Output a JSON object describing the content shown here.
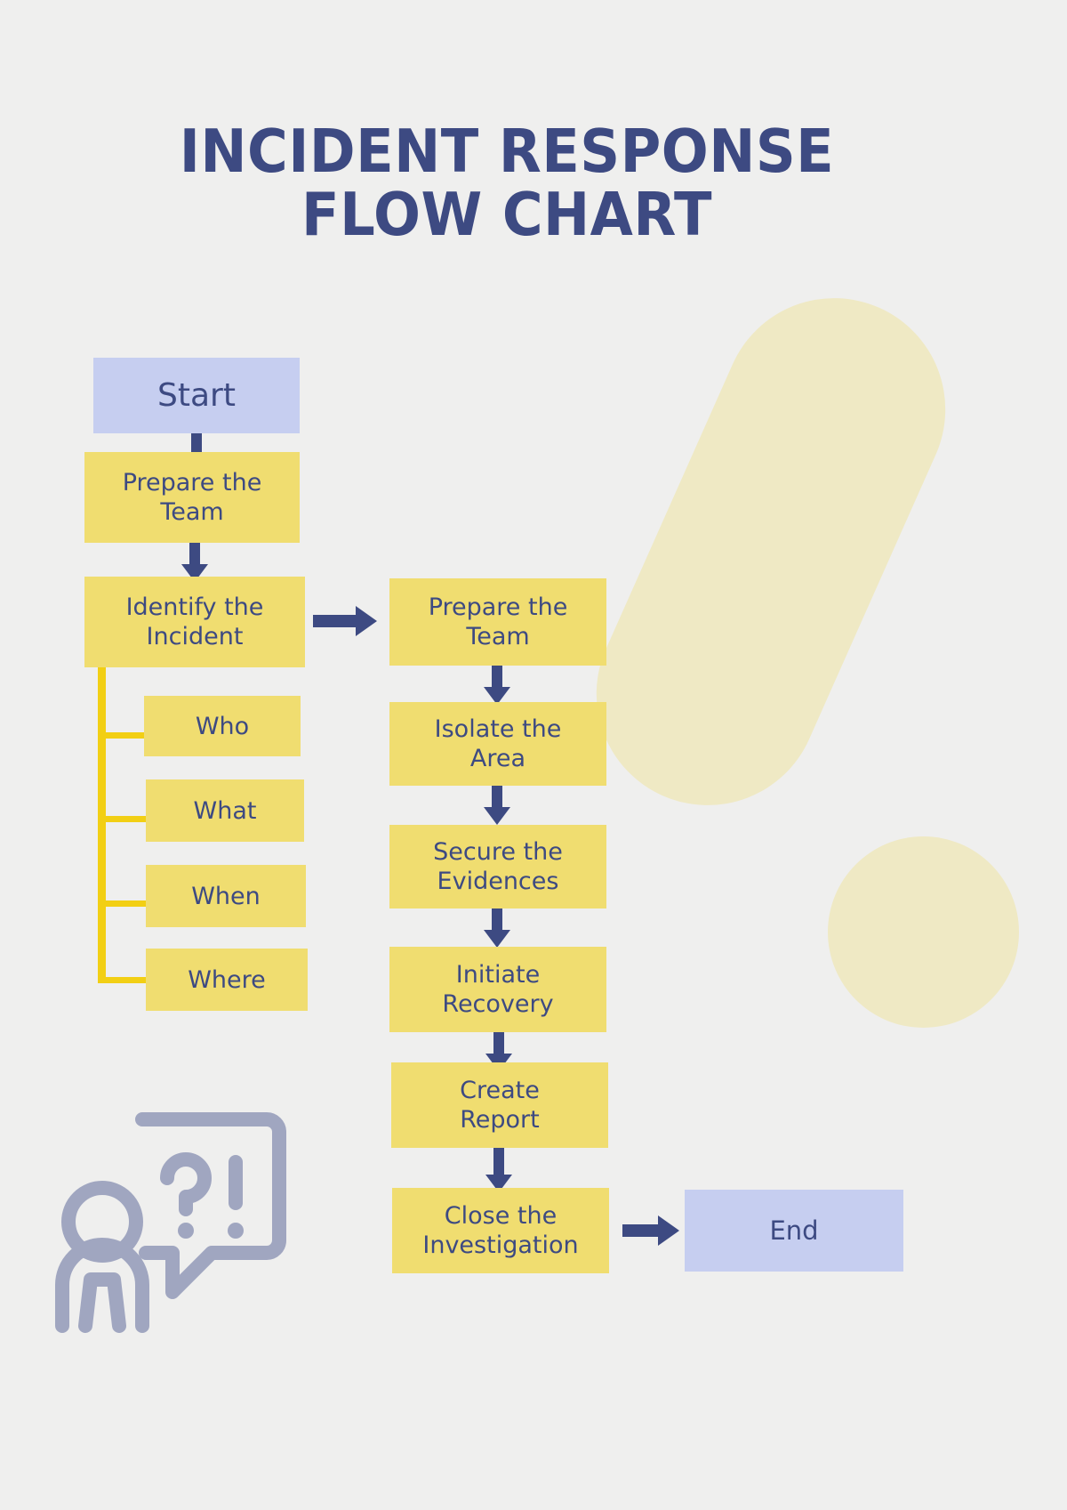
{
  "title": {
    "line1": "INCIDENT RESPONSE",
    "line2": "FLOW CHART"
  },
  "colors": {
    "background": "#efefee",
    "accent_navy": "#3d4a82",
    "box_yellow": "#f0dd70",
    "box_blue": "#c6cef0",
    "bracket_gold": "#f2cf14",
    "decor_pale_yellow": "#efe9c4",
    "icon_gray": "#a0a6c0"
  },
  "chart_data": {
    "type": "diagram",
    "diagram_type": "flowchart",
    "title": "Incident Response Flow Chart",
    "nodes": [
      {
        "id": "start",
        "label": "Start",
        "shape": "rect",
        "fill": "#c6cef0",
        "column": "left"
      },
      {
        "id": "prepare1",
        "label": "Prepare the Team",
        "shape": "rect",
        "fill": "#f0dd70",
        "column": "left"
      },
      {
        "id": "identify",
        "label": "Identify the Incident",
        "shape": "rect",
        "fill": "#f0dd70",
        "column": "left"
      },
      {
        "id": "who",
        "label": "Who",
        "shape": "rect",
        "fill": "#f0dd70",
        "column": "left-sub"
      },
      {
        "id": "what",
        "label": "What",
        "shape": "rect",
        "fill": "#f0dd70",
        "column": "left-sub"
      },
      {
        "id": "when",
        "label": "When",
        "shape": "rect",
        "fill": "#f0dd70",
        "column": "left-sub"
      },
      {
        "id": "where",
        "label": "Where",
        "shape": "rect",
        "fill": "#f0dd70",
        "column": "left-sub"
      },
      {
        "id": "prepare2",
        "label": "Prepare the Team",
        "shape": "rect",
        "fill": "#f0dd70",
        "column": "right"
      },
      {
        "id": "isolate",
        "label": "Isolate the Area",
        "shape": "rect",
        "fill": "#f0dd70",
        "column": "right"
      },
      {
        "id": "secure",
        "label": "Secure the Evidences",
        "shape": "rect",
        "fill": "#f0dd70",
        "column": "right"
      },
      {
        "id": "recovery",
        "label": "Initiate Recovery",
        "shape": "rect",
        "fill": "#f0dd70",
        "column": "right"
      },
      {
        "id": "report",
        "label": "Create Report",
        "shape": "rect",
        "fill": "#f0dd70",
        "column": "right"
      },
      {
        "id": "close",
        "label": "Close the Investigation",
        "shape": "rect",
        "fill": "#f0dd70",
        "column": "right"
      },
      {
        "id": "end",
        "label": "End",
        "shape": "rect",
        "fill": "#c6cef0",
        "column": "right-end"
      }
    ],
    "edges": [
      {
        "from": "start",
        "to": "prepare1",
        "type": "arrow-down"
      },
      {
        "from": "prepare1",
        "to": "identify",
        "type": "arrow-down"
      },
      {
        "from": "identify",
        "to": "prepare2",
        "type": "arrow-right"
      },
      {
        "from": "identify",
        "to": "who",
        "type": "bracket"
      },
      {
        "from": "identify",
        "to": "what",
        "type": "bracket"
      },
      {
        "from": "identify",
        "to": "when",
        "type": "bracket"
      },
      {
        "from": "identify",
        "to": "where",
        "type": "bracket"
      },
      {
        "from": "prepare2",
        "to": "isolate",
        "type": "arrow-down"
      },
      {
        "from": "isolate",
        "to": "secure",
        "type": "arrow-down"
      },
      {
        "from": "secure",
        "to": "recovery",
        "type": "arrow-down"
      },
      {
        "from": "recovery",
        "to": "report",
        "type": "arrow-down"
      },
      {
        "from": "report",
        "to": "close",
        "type": "arrow-down"
      },
      {
        "from": "close",
        "to": "end",
        "type": "arrow-right"
      }
    ]
  },
  "flow": {
    "left_column": {
      "start": "Start",
      "prepare_team": "Prepare the\nTeam",
      "prepare_team_l1": "Prepare the",
      "prepare_team_l2": "Team",
      "identify_l1": "Identify the",
      "identify_l2": "Incident"
    },
    "sub_items": [
      {
        "label": "Who"
      },
      {
        "label": "What"
      },
      {
        "label": "When"
      },
      {
        "label": "Where"
      }
    ],
    "right_column": [
      {
        "line1": "Prepare the",
        "line2": "Team"
      },
      {
        "line1": "Isolate the",
        "line2": "Area"
      },
      {
        "line1": "Secure the",
        "line2": "Evidences"
      },
      {
        "line1": "Initiate",
        "line2": "Recovery"
      },
      {
        "line1": "Create",
        "line2": "Report"
      },
      {
        "line1": "Close the",
        "line2": "Investigation"
      }
    ],
    "end": "End"
  },
  "decorations": {
    "exclamation_mark": "exclamation-mark-shape",
    "person_question": "person-with-question-exclamation-speech-bubble-icon"
  }
}
